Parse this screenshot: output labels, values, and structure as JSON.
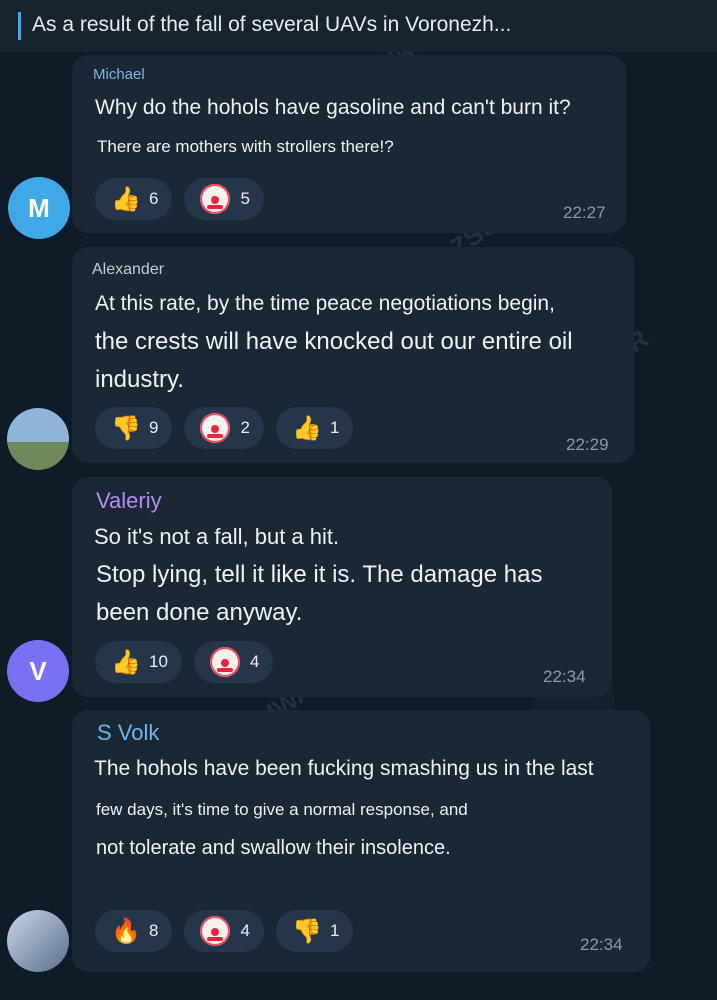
{
  "header": {
    "title": "As a result of the fall of several UAVs in Voronezh..."
  },
  "watermark": "@ZSUWAR",
  "messages": [
    {
      "author": "Michael",
      "author_color": "#7fb6e6",
      "avatar_letter": "M",
      "lines": [
        "Why do the hohols have gasoline and can't burn it?",
        "There are mothers with strollers there!?"
      ],
      "reactions": [
        {
          "icon": "thumbs-up-icon",
          "count": "6"
        },
        {
          "icon": "clown-face-icon",
          "count": "5"
        }
      ],
      "time": "22:27"
    },
    {
      "author": "Alexander",
      "author_color": "#c8ccd1",
      "avatar_letter": "",
      "lines": [
        "At this rate, by the time peace negotiations begin,",
        "the crests will have knocked out our entire oil",
        "industry."
      ],
      "reactions": [
        {
          "icon": "thumbs-down-icon",
          "count": "9"
        },
        {
          "icon": "clown-face-icon",
          "count": "2"
        },
        {
          "icon": "thumbs-up-icon",
          "count": "1"
        }
      ],
      "time": "22:29"
    },
    {
      "author": "Valeriy",
      "author_color": "#b58cf0",
      "avatar_letter": "V",
      "lines": [
        "So it's not a fall, but a hit.",
        "Stop lying, tell it like it is. The damage has",
        "been done anyway."
      ],
      "reactions": [
        {
          "icon": "thumbs-up-icon",
          "count": "10"
        },
        {
          "icon": "clown-face-icon",
          "count": "4"
        }
      ],
      "time": "22:34"
    },
    {
      "author": "S Volk",
      "author_color": "#6fb4ee",
      "avatar_letter": "",
      "lines": [
        "The hohols have been fucking smashing us in the last",
        "few days, it's time to give a normal response, and",
        "not tolerate and swallow their insolence."
      ],
      "reactions": [
        {
          "icon": "fire-icon",
          "count": "8"
        },
        {
          "icon": "clown-face-icon",
          "count": "4"
        },
        {
          "icon": "thumbs-down-icon",
          "count": "1"
        }
      ],
      "time": "22:34"
    }
  ]
}
